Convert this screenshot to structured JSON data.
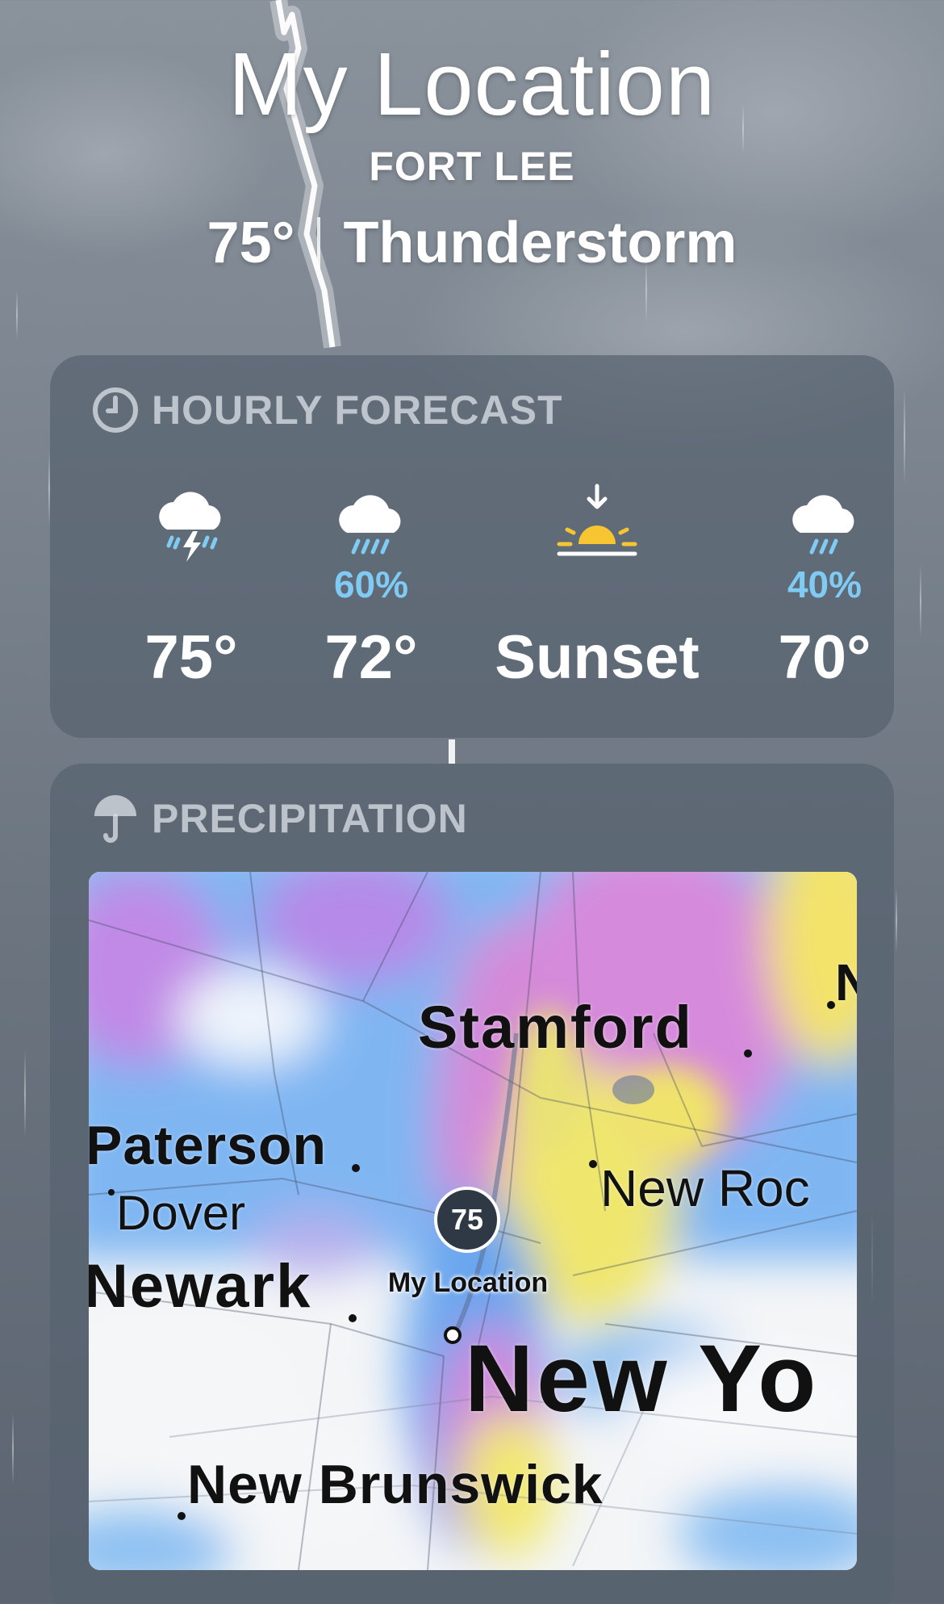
{
  "header": {
    "title": "My Location",
    "subtitle": "FORT LEE",
    "temperature": "75°",
    "condition": "Thunderstorm"
  },
  "hourly": {
    "heading": "HOURLY FORECAST",
    "icon": "clock-icon",
    "items": [
      {
        "icon": "cloud-bolt-rain-icon",
        "precip": "",
        "temp": "75°"
      },
      {
        "icon": "cloud-rain-icon",
        "precip": "60%",
        "temp": "72°"
      },
      {
        "icon": "sunset-icon",
        "precip": "",
        "temp": "Sunset"
      },
      {
        "icon": "cloud-rain-icon",
        "precip": "40%",
        "temp": "70°"
      }
    ]
  },
  "precipitation": {
    "heading": "PRECIPITATION",
    "icon": "umbrella-icon",
    "map": {
      "pin_value": "75",
      "pin_label": "My Location",
      "cities": {
        "stamford": "Stamford",
        "paterson": "Paterson",
        "dover": "Dover",
        "newark": "Newark",
        "new_rochelle": "New Roc",
        "new_york": "New Yo",
        "new_brunswick": "New Brunswick",
        "edge_n": "N"
      }
    }
  },
  "colors": {
    "precip_percent": "#7fcbf4",
    "sun": "#f7c531",
    "card_bg": "rgba(88,98,112,0.72)"
  }
}
